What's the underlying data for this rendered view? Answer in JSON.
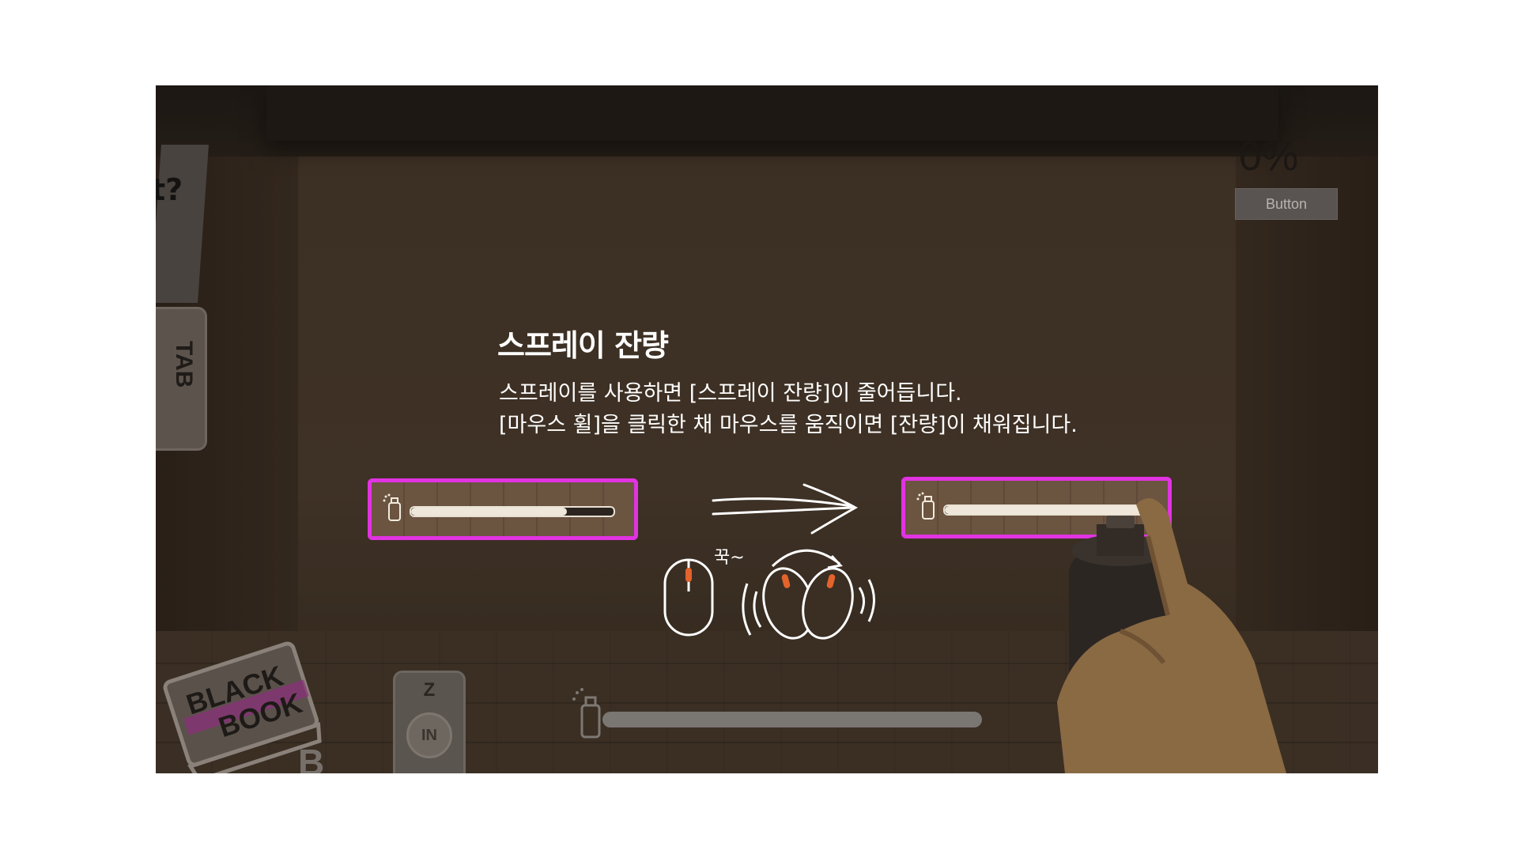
{
  "hud": {
    "percent": "0%",
    "button_label": "Button",
    "tab_label": "TAB",
    "z_key": {
      "label": "Z",
      "sub": "IN"
    },
    "black_book": {
      "line1": "BLACK",
      "line2": "BOOK",
      "key": "B"
    },
    "background_sign": "t?",
    "spray_bar_level": 0
  },
  "tutorial": {
    "title": "스프레이 잔량",
    "line1": "스프레이를 사용하면 [스프레이 잔량]이 줄어듭니다.",
    "line2": "[마우스 휠]을 클릭한 채 마우스를 움직이면 [잔량]이 채워집니다.",
    "before_level": 0.77,
    "after_level": 1.0,
    "press_sound": "꾹~"
  },
  "colors": {
    "highlight": "#e133e2",
    "text": "#ffffff"
  }
}
